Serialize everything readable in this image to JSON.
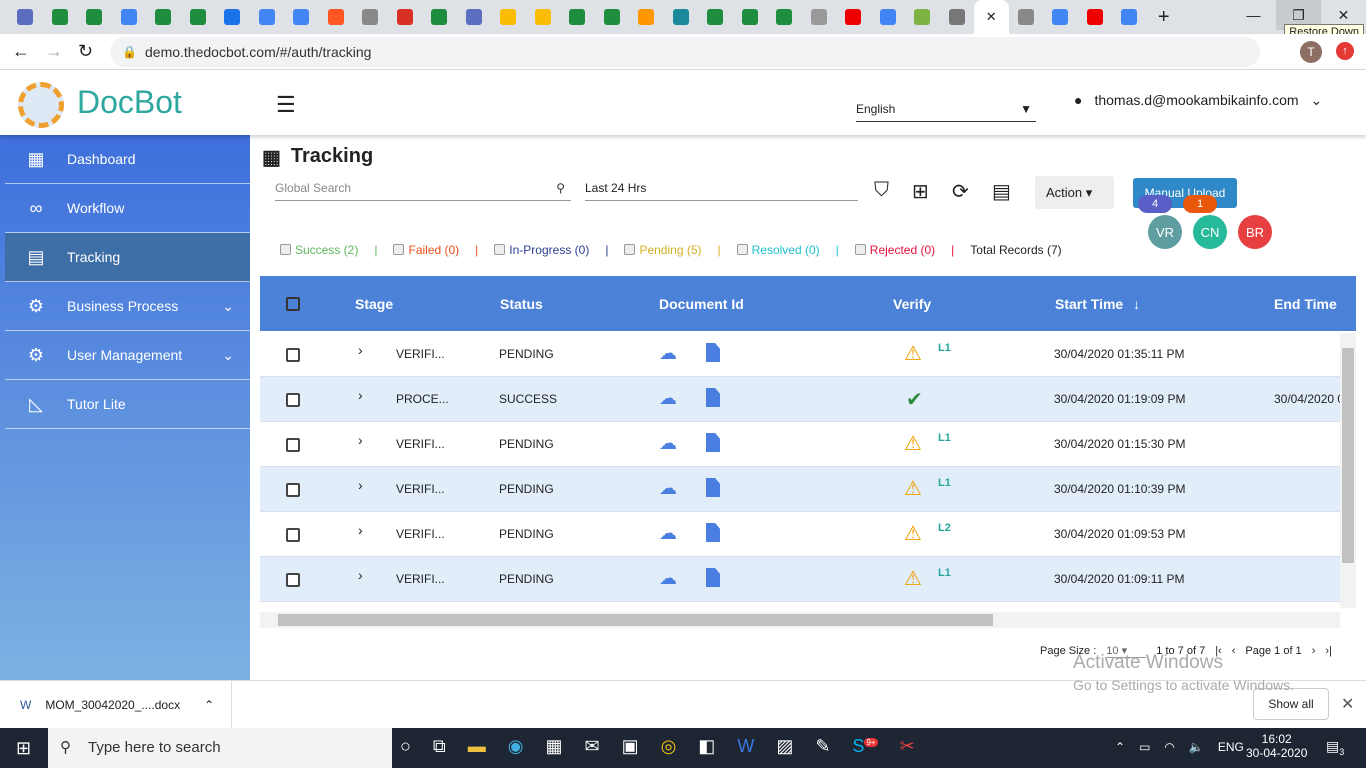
{
  "browser": {
    "tab_colors": [
      "#5b6dbf",
      "#1e8e3e",
      "#1e8e3e",
      "#4285f4",
      "#1e8e3e",
      "#1e8e3e",
      "#1a73e8",
      "#4285f4",
      "#4285f4",
      "#ff5722",
      "#888",
      "#d93025",
      "#1e8e3e",
      "#5b6dbf",
      "#fbbc04",
      "#fbbc04",
      "#1e8e3e",
      "#1e8e3e",
      "#ff9800",
      "#1a8a9a",
      "#1e8e3e",
      "#1e8e3e",
      "#1e8e3e",
      "#999",
      "#e00",
      "#4285f4",
      "#7cb342",
      "#777",
      "#fff",
      "#888",
      "#4285f4",
      "#e00",
      "#4285f4"
    ],
    "new_tab": "+",
    "url": "demo.thedocbot.com/#/auth/tracking",
    "tooltip": "Restore Down",
    "profile_initial": "T"
  },
  "app": {
    "logo": "DocBot",
    "language": "English",
    "user": "thomas.d@mookambikainfo.com"
  },
  "sidebar": {
    "items": [
      {
        "label": "Dashboard",
        "icon": "dashboard-icon",
        "glyph": "▦"
      },
      {
        "label": "Workflow",
        "icon": "infinity-icon",
        "glyph": "∞"
      },
      {
        "label": "Tracking",
        "icon": "table-icon",
        "glyph": "▤",
        "active": true
      },
      {
        "label": "Business Process",
        "icon": "gear-icon",
        "glyph": "⚙",
        "chevron": "⌄"
      },
      {
        "label": "User Management",
        "icon": "gear-icon",
        "glyph": "⚙",
        "chevron": "⌄"
      },
      {
        "label": "Tutor Lite",
        "icon": "set-square-icon",
        "glyph": "◺"
      }
    ]
  },
  "page": {
    "title": "Tracking",
    "search_placeholder": "Global Search",
    "date_range": "Last 24 Hrs",
    "action": "Action",
    "manual_upload": "Manual Upload"
  },
  "filters": [
    {
      "label": "Success (2)",
      "color": "#5cb85c"
    },
    {
      "label": "Failed (0)",
      "color": "#e8501a"
    },
    {
      "label": "In-Progress (0)",
      "color": "#2a3f8f"
    },
    {
      "label": "Pending (5)",
      "color": "#d4b020"
    },
    {
      "label": "Resolved (0)",
      "color": "#20c0d0"
    },
    {
      "label": "Rejected (0)",
      "color": "#e8103a"
    }
  ],
  "total_records": "Total Records (7)",
  "avatars": [
    {
      "label": "VR",
      "color": "#5f9ea0",
      "count": "4",
      "count_color": "#5a5fc8"
    },
    {
      "label": "CN",
      "color": "#26b99a",
      "count": "1",
      "count_color": "#e8580c"
    },
    {
      "label": "BR",
      "color": "#e84040"
    }
  ],
  "table": {
    "columns": [
      "Stage",
      "Status",
      "Document Id",
      "Verify",
      "Start Time",
      "End Time"
    ],
    "sort_icon": "↓",
    "rows": [
      {
        "stage": "VERIFI...",
        "status": "PENDING",
        "verify": "warning",
        "level": "L1",
        "start": "30/04/2020 01:35:11 PM",
        "end": ""
      },
      {
        "stage": "PROCE...",
        "status": "SUCCESS",
        "verify": "check",
        "level": "",
        "start": "30/04/2020 01:19:09 PM",
        "end": "30/04/2020 0"
      },
      {
        "stage": "VERIFI...",
        "status": "PENDING",
        "verify": "warning",
        "level": "L1",
        "start": "30/04/2020 01:15:30 PM",
        "end": ""
      },
      {
        "stage": "VERIFI...",
        "status": "PENDING",
        "verify": "warning",
        "level": "L1",
        "start": "30/04/2020 01:10:39 PM",
        "end": ""
      },
      {
        "stage": "VERIFI...",
        "status": "PENDING",
        "verify": "warning",
        "level": "L2",
        "start": "30/04/2020 01:09:53 PM",
        "end": ""
      },
      {
        "stage": "VERIFI...",
        "status": "PENDING",
        "verify": "warning",
        "level": "L1",
        "start": "30/04/2020 01:09:11 PM",
        "end": ""
      }
    ]
  },
  "pagination": {
    "page_size_label": "Page Size :",
    "page_size": "10",
    "range": "1 to 7 of 7",
    "page": "Page 1 of 1"
  },
  "watermark": {
    "line1": "Activate Windows",
    "line2": "Go to Settings to activate Windows."
  },
  "download": {
    "file": "MOM_30042020_....docx",
    "show_all": "Show all"
  },
  "taskbar": {
    "search": "Type here to search",
    "lang": "ENG",
    "time": "16:02",
    "date": "30-04-2020",
    "notifications": "3",
    "skype_badge": "9+"
  }
}
